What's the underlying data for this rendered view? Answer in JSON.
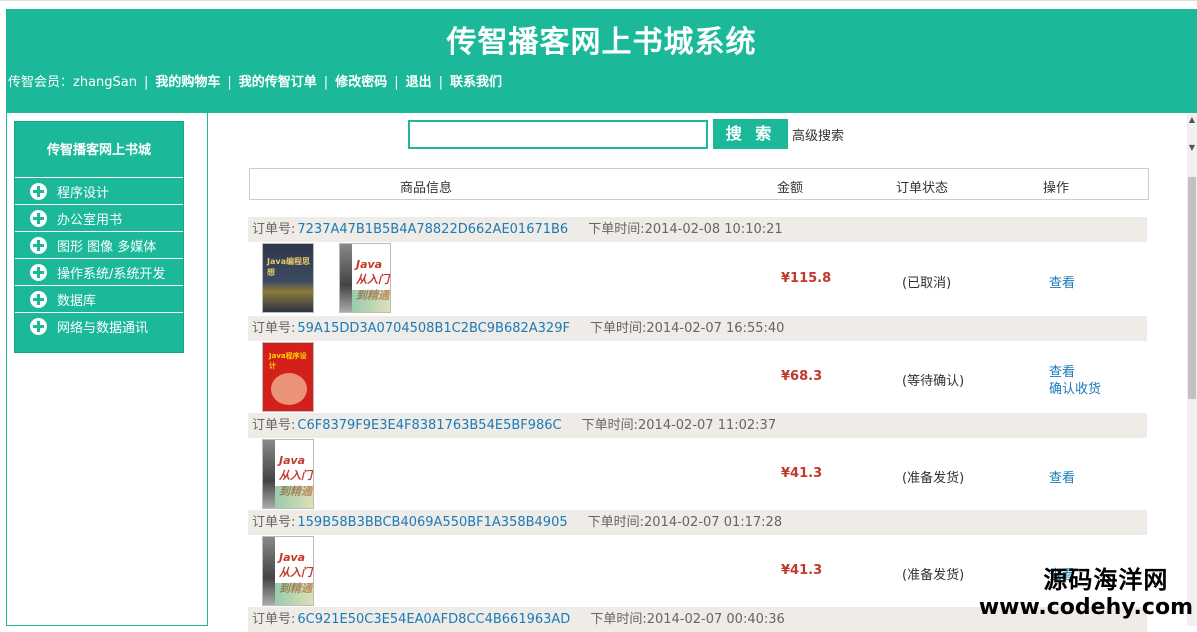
{
  "header": {
    "title": "传智播客网上书城系统",
    "member_label": "传智会员：zhangSan",
    "links": [
      "我的购物车",
      "我的传智订单",
      "修改密码",
      "退出",
      "联系我们"
    ]
  },
  "sidebar": {
    "title": "传智播客网上书城",
    "items": [
      "程序设计",
      "办公室用书",
      "图形 图像 多媒体",
      "操作系统/系统开发",
      "数据库",
      "网络与数据通讯"
    ]
  },
  "search": {
    "value": "",
    "button_label": "搜 索",
    "advanced_label": "高级搜索"
  },
  "table": {
    "headers": [
      "商品信息",
      "金额",
      "订单状态",
      "操作"
    ]
  },
  "orders": [
    {
      "id_label": "订单号:",
      "id": "7237A47B1B5B4A78822D662AE01671B6",
      "time_label": "下单时间:",
      "time": "2014-02-08 10:10:21",
      "books": [
        "Java编程思想",
        "Java 从入门到精通"
      ],
      "price": "¥115.8",
      "status": "(已取消)",
      "actions": [
        "查看"
      ]
    },
    {
      "id_label": "订单号:",
      "id": "59A15DD3A0704508B1C2BC9B682A329F",
      "time_label": "下单时间:",
      "time": "2014-02-07 16:55:40",
      "books": [
        "Java程序设计"
      ],
      "price": "¥68.3",
      "status": "(等待确认)",
      "actions": [
        "查看",
        "确认收货"
      ]
    },
    {
      "id_label": "订单号:",
      "id": "C6F8379F9E3E4F8381763B54E5BF986C",
      "time_label": "下单时间:",
      "time": "2014-02-07 11:02:37",
      "books": [
        "Java 从入门到精通"
      ],
      "price": "¥41.3",
      "status": "(准备发货)",
      "actions": [
        "查看"
      ]
    },
    {
      "id_label": "订单号:",
      "id": "159B58B3BBCB4069A550BF1A358B4905",
      "time_label": "下单时间:",
      "time": "2014-02-07 01:17:28",
      "books": [
        "Java 从入门到精通"
      ],
      "price": "¥41.3",
      "status": "(准备发货)",
      "actions": [
        "查看"
      ]
    },
    {
      "id_label": "订单号:",
      "id": "6C921E50C3E54EA0AFD8CC4B661963AD",
      "time_label": "下单时间:",
      "time": "2014-02-07 00:40:36"
    }
  ],
  "watermark": {
    "line1": "源码海洋网",
    "line2": "www.codehy.com"
  },
  "colors": {
    "brand": "#1bb99a",
    "price": "#c0392b",
    "link": "#1a7bb9",
    "order_header_bg": "#efebe6"
  }
}
